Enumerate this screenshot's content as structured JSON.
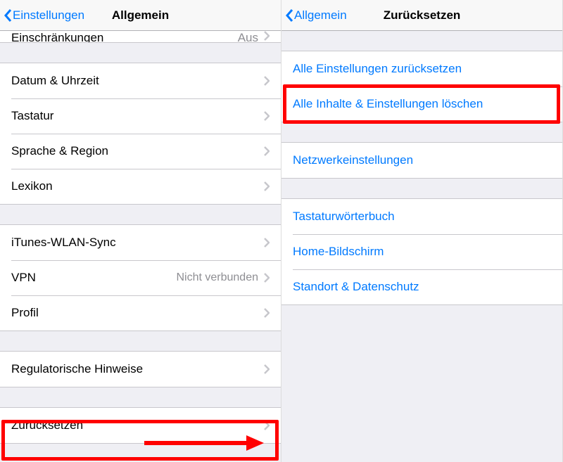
{
  "left": {
    "nav": {
      "back": "Einstellungen",
      "title": "Allgemein"
    },
    "cutRow": {
      "label": "Einschränkungen",
      "value": "Aus"
    },
    "group1": [
      {
        "label": "Datum & Uhrzeit"
      },
      {
        "label": "Tastatur"
      },
      {
        "label": "Sprache & Region"
      },
      {
        "label": "Lexikon"
      }
    ],
    "group2": [
      {
        "label": "iTunes-WLAN-Sync"
      },
      {
        "label": "VPN",
        "value": "Nicht verbunden"
      },
      {
        "label": "Profil"
      }
    ],
    "group3": [
      {
        "label": "Regulatorische Hinweise"
      }
    ],
    "group4": [
      {
        "label": "Zurücksetzen"
      }
    ]
  },
  "right": {
    "nav": {
      "back": "Allgemein",
      "title": "Zurücksetzen"
    },
    "group1": [
      {
        "label": "Alle Einstellungen zurücksetzen"
      },
      {
        "label": "Alle Inhalte & Einstellungen löschen"
      }
    ],
    "group2": [
      {
        "label": "Netzwerkeinstellungen"
      }
    ],
    "group3": [
      {
        "label": "Tastaturwörterbuch"
      },
      {
        "label": "Home-Bildschirm"
      },
      {
        "label": "Standort & Datenschutz"
      }
    ]
  }
}
